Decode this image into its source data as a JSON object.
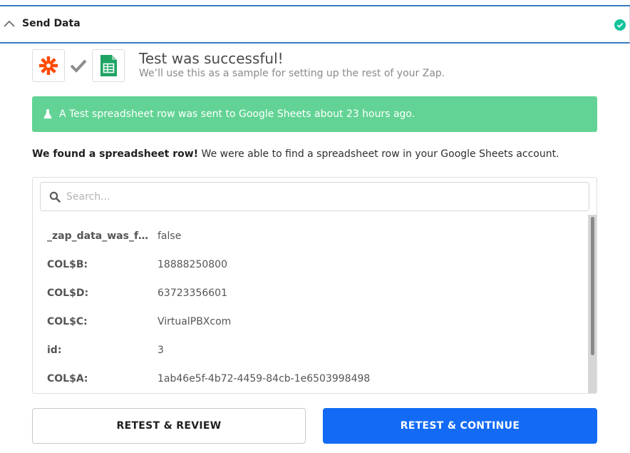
{
  "header": {
    "title": "Send Data",
    "status_color": "#13c39c",
    "collapse_icon": "chevron-up-icon",
    "status_icon": "check-circle-icon"
  },
  "apps": {
    "trigger_icon": "zapier-icon",
    "connector_icon": "check-icon",
    "action_icon": "google-sheets-icon"
  },
  "result": {
    "title": "Test was successful!",
    "subtitle": "We’ll use this as a sample for setting up the rest of your Zap."
  },
  "alert": {
    "icon": "flask-icon",
    "text": "A Test spreadsheet row was sent to Google Sheets about 23 hours ago.",
    "color": "#62d394"
  },
  "found": {
    "bold": "We found a spreadsheet row!",
    "rest": " We were able to find a spreadsheet row in your Google Sheets account."
  },
  "search": {
    "placeholder": "Search...",
    "value": ""
  },
  "rows": [
    {
      "key": "_zap_data_was_found",
      "value": "false"
    },
    {
      "key": "COL$B:",
      "value": "18888250800"
    },
    {
      "key": "COL$D:",
      "value": "63723356601"
    },
    {
      "key": "COL$C:",
      "value": "VirtualPBXcom"
    },
    {
      "key": "id:",
      "value": "3"
    },
    {
      "key": "COL$A:",
      "value": "1ab46e5f-4b72-4459-84cb-1e6503998498"
    }
  ],
  "buttons": {
    "retest_review": "RETEST & REVIEW",
    "retest_continue": "RETEST & CONTINUE",
    "primary_color": "#136bf5"
  }
}
